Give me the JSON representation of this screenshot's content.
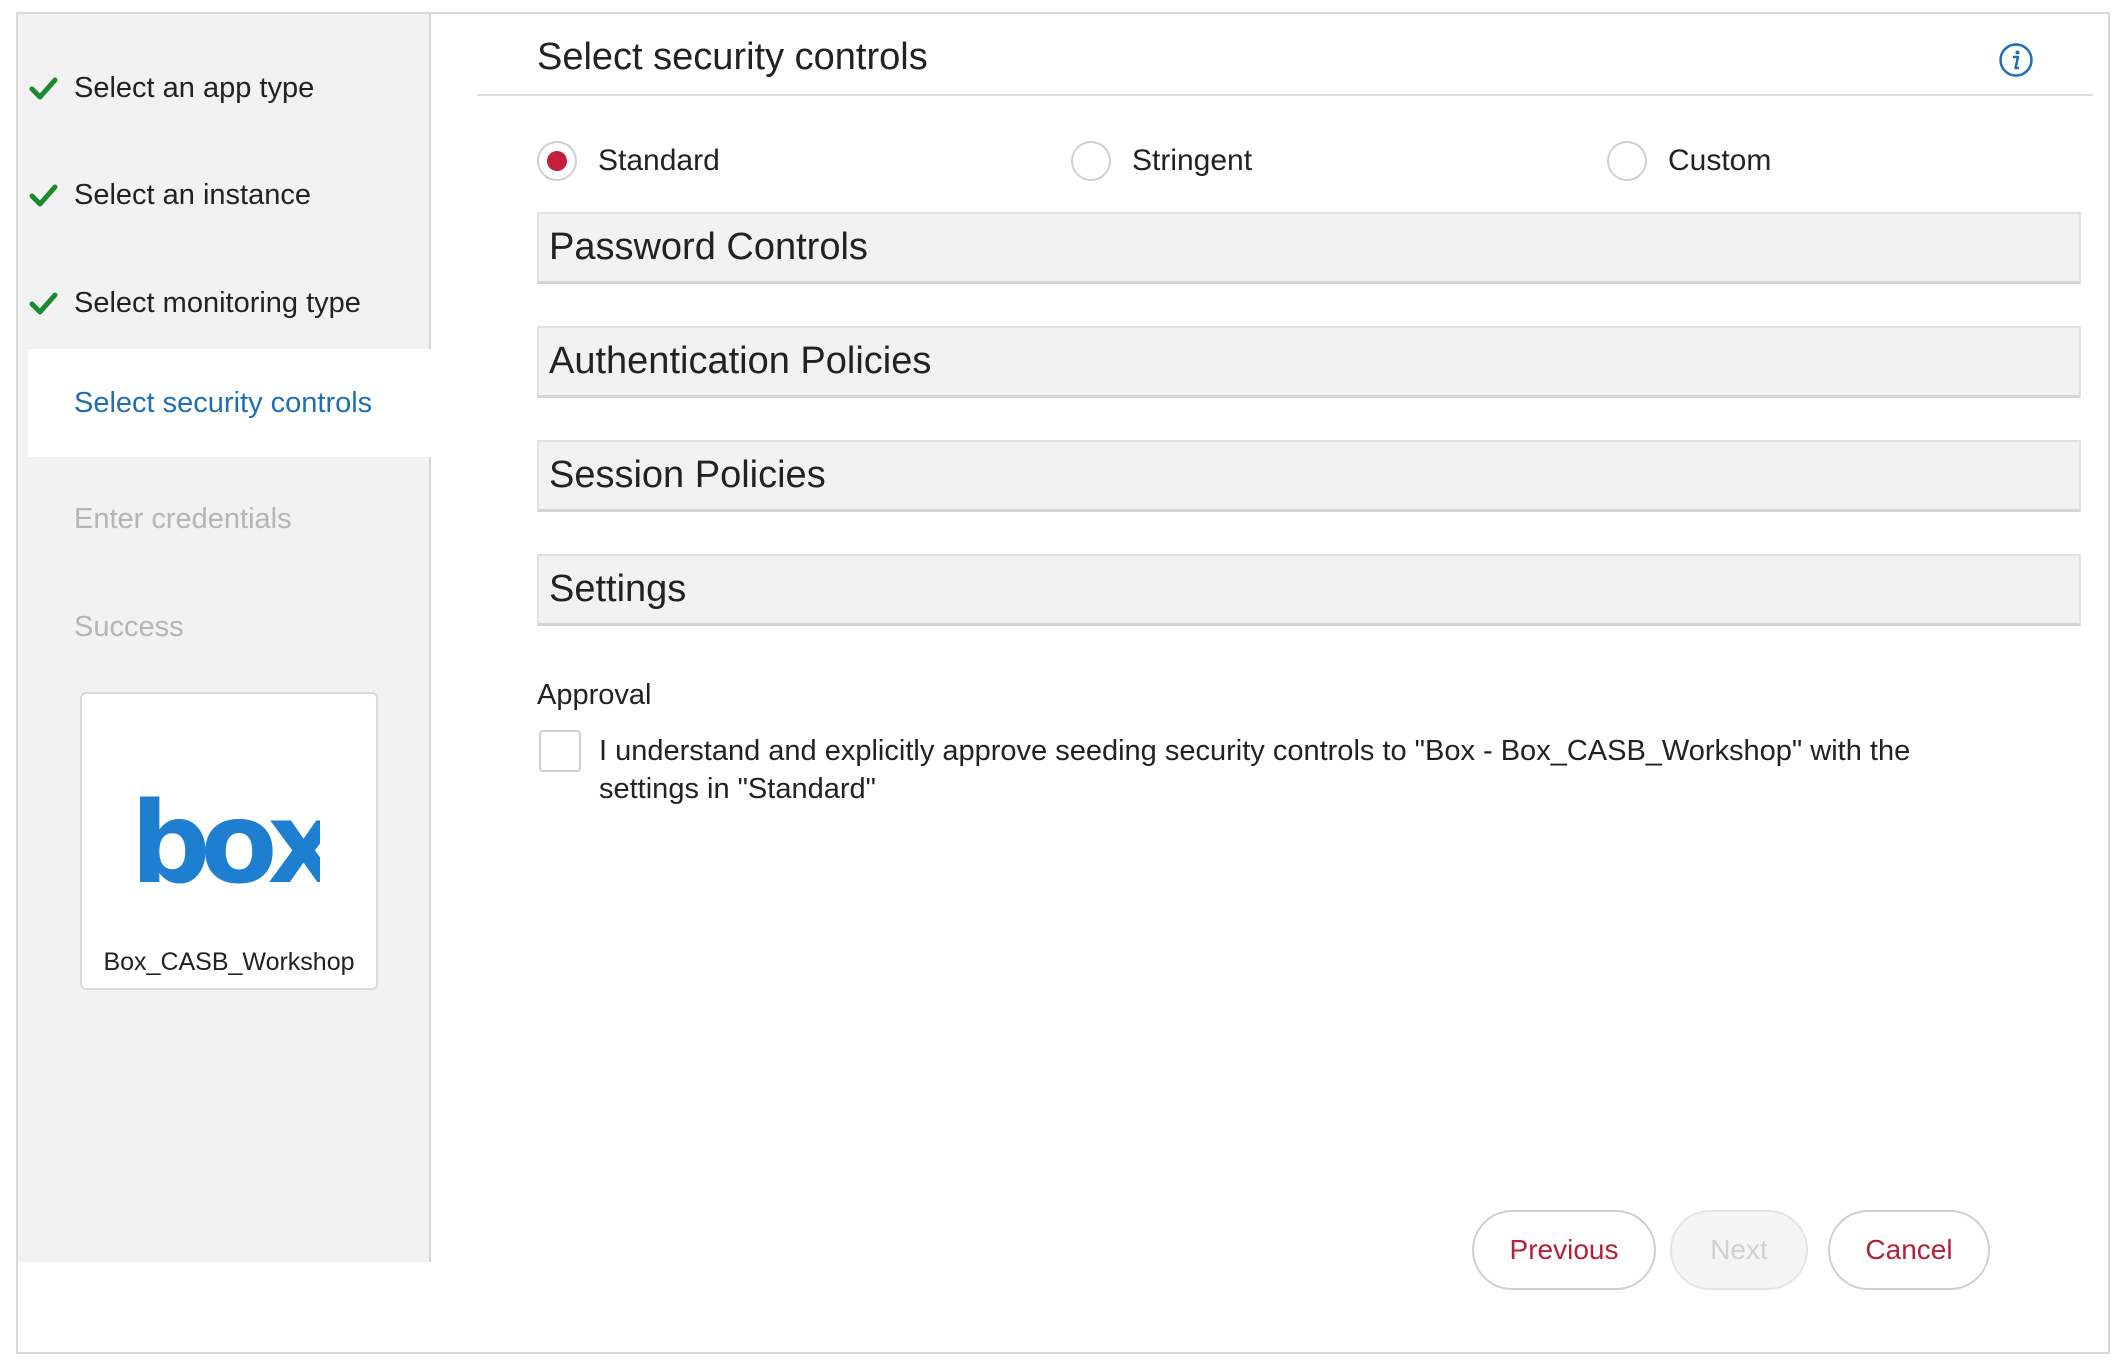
{
  "wizard": {
    "steps": [
      {
        "label": "Select an app type",
        "state": "done"
      },
      {
        "label": "Select an instance",
        "state": "done"
      },
      {
        "label": "Select monitoring type",
        "state": "done"
      },
      {
        "label": "Select security controls",
        "state": "active"
      },
      {
        "label": "Enter credentials",
        "state": "pending"
      },
      {
        "label": "Success",
        "state": "pending"
      }
    ],
    "app": {
      "logo_text": "box",
      "name": "Box_CASB_Workshop"
    }
  },
  "main": {
    "title": "Select security controls",
    "info_icon": "info-icon",
    "profiles": [
      {
        "label": "Standard",
        "selected": true
      },
      {
        "label": "Stringent",
        "selected": false
      },
      {
        "label": "Custom",
        "selected": false
      }
    ],
    "sections": [
      "Password Controls",
      "Authentication Policies",
      "Session Policies",
      "Settings"
    ],
    "approval": {
      "title": "Approval",
      "checked": false,
      "text": "I understand and explicitly approve seeding security controls to \"Box - Box_CASB_Workshop\" with the settings in \"Standard\""
    }
  },
  "buttons": {
    "previous": "Previous",
    "next": "Next",
    "cancel": "Cancel"
  },
  "colors": {
    "accent_red": "#c3213b",
    "active_blue": "#1f6fb5",
    "check_green": "#1a8a2e",
    "box_blue": "#1e7fd0"
  }
}
